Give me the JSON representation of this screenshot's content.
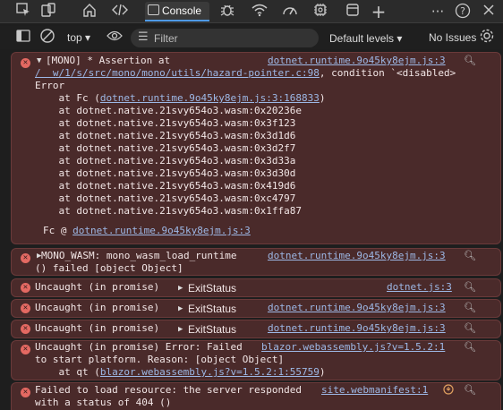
{
  "tabs": {
    "console_label": "Console"
  },
  "toolbar": {
    "context": "top",
    "filter_placeholder": "Filter",
    "levels": "Default levels",
    "issues": "No Issues"
  },
  "messages": {
    "m1": {
      "lines": [
        "[MONO] * Assertion at",
        "Error",
        "    at Fc (",
        "    at dotnet.native.21svy654o3.wasm:0x20236e",
        "    at dotnet.native.21svy654o3.wasm:0x3f123",
        "    at dotnet.native.21svy654o3.wasm:0x3d1d6",
        "    at dotnet.native.21svy654o3.wasm:0x3d2f7",
        "    at dotnet.native.21svy654o3.wasm:0x3d33a",
        "    at dotnet.native.21svy654o3.wasm:0x3d30d",
        "    at dotnet.native.21svy654o3.wasm:0x419d6",
        "    at dotnet.native.21svy654o3.wasm:0xc4797",
        "    at dotnet.native.21svy654o3.wasm:0x1ffa87"
      ],
      "path": "/  w/1/s/src/mono/mono/utils/hazard-pointer.c:98",
      "cond": ", condition `<disabled>",
      "fc_link": "dotnet.runtime.9o45ky8ejm.js:3:168833",
      "fc_close": ")",
      "source": "dotnet.runtime.9o45ky8ejm.js:3",
      "footer_prefix": "Fc @ ",
      "footer_link": "dotnet.runtime.9o45ky8ejm.js:3"
    },
    "m2": {
      "line1": "MONO_WASM: mono_wasm_load_runtime",
      "line2": "() failed [object Object]",
      "source": "dotnet.runtime.9o45ky8ejm.js:3"
    },
    "m3": {
      "text": "Uncaught (in promise)",
      "obj": "ExitStatus",
      "source": "dotnet.js:3"
    },
    "m4": {
      "text": "Uncaught (in promise)",
      "obj": "ExitStatus",
      "source": "dotnet.runtime.9o45ky8ejm.js:3"
    },
    "m5": {
      "text": "Uncaught (in promise)",
      "obj": "ExitStatus",
      "source": "dotnet.runtime.9o45ky8ejm.js:3"
    },
    "m6": {
      "line1": "Uncaught (in promise) Error: Failed",
      "line2": "to start platform. Reason: [object Object]",
      "line3": "    at qt (",
      "qt_link": "blazor.webassembly.js?v=1.5.2:1:55759",
      "qt_close": ")",
      "source": "blazor.webassembly.js?v=1.5.2:1"
    },
    "m7": {
      "line1": "Failed to load resource: the server responded",
      "line2": "with a status of 404 ()",
      "source": "site.webmanifest:1"
    }
  }
}
